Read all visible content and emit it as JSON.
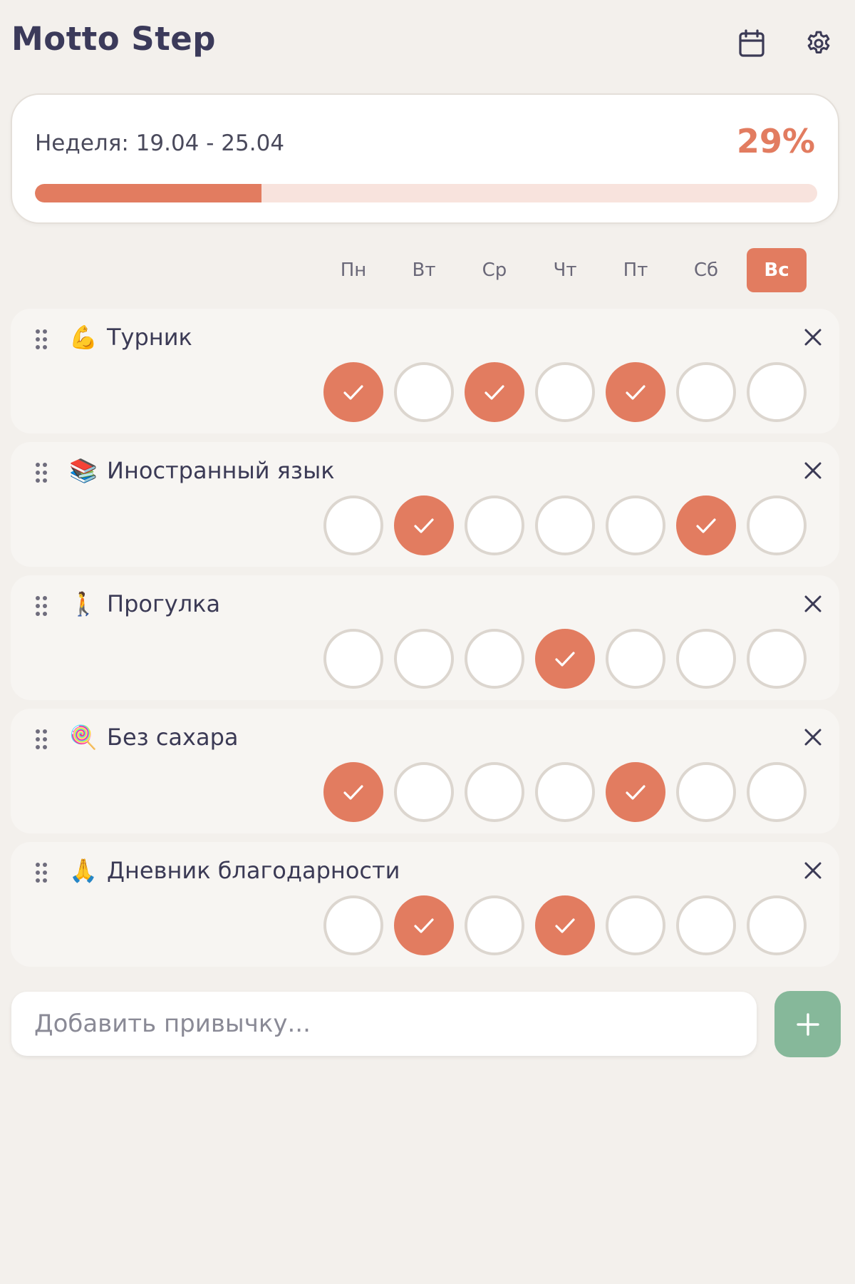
{
  "app": {
    "title": "Motto Step"
  },
  "header": {
    "calendar_icon": "calendar-icon",
    "settings_icon": "gear-icon"
  },
  "week": {
    "label": "Неделя: 19.04 - 25.04",
    "percent_text": "29%",
    "progress": 0.29
  },
  "days": [
    "Пн",
    "Вт",
    "Ср",
    "Чт",
    "Пт",
    "Сб",
    "Вс"
  ],
  "today_index": 6,
  "colors": {
    "accent": "#e27c60",
    "accent_light": "#f8e3dd",
    "add": "#86b89a",
    "bg": "#f3f0ec"
  },
  "habits": [
    {
      "emoji": "💪",
      "name": "Турник",
      "checks": [
        true,
        false,
        true,
        false,
        true,
        false,
        false
      ]
    },
    {
      "emoji": "📚",
      "name": "Иностранный язык",
      "checks": [
        false,
        true,
        false,
        false,
        false,
        true,
        false
      ]
    },
    {
      "emoji": "🚶",
      "name": "Прогулка",
      "checks": [
        false,
        false,
        false,
        true,
        false,
        false,
        false
      ]
    },
    {
      "emoji": "🍭",
      "name": "Без сахара",
      "checks": [
        true,
        false,
        false,
        false,
        true,
        false,
        false
      ]
    },
    {
      "emoji": "🙏",
      "name": "Дневник благодарности",
      "checks": [
        false,
        true,
        false,
        true,
        false,
        false,
        false
      ]
    }
  ],
  "add_habit": {
    "placeholder": "Добавить привычку...",
    "value": ""
  }
}
